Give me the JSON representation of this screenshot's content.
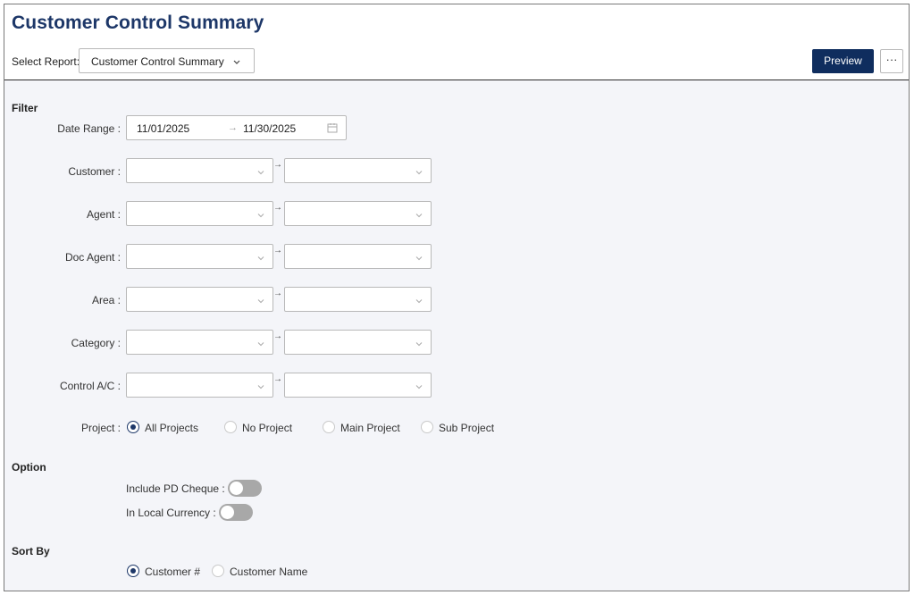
{
  "header": {
    "title": "Customer Control Summary",
    "select_report_label": "Select Report:",
    "selected_report": "Customer Control Summary",
    "preview_label": "Preview",
    "more_label": "···"
  },
  "filter": {
    "section_label": "Filter",
    "date_range": {
      "label": "Date Range :",
      "from": "11/01/2025",
      "arrow": "→",
      "to": "11/30/2025"
    },
    "ranges": [
      {
        "label": "Customer :",
        "from": "",
        "to": ""
      },
      {
        "label": "Agent :",
        "from": "",
        "to": ""
      },
      {
        "label": "Doc Agent :",
        "from": "",
        "to": ""
      },
      {
        "label": "Area :",
        "from": "",
        "to": ""
      },
      {
        "label": "Category :",
        "from": "",
        "to": ""
      },
      {
        "label": "Control A/C :",
        "from": "",
        "to": ""
      }
    ],
    "range_arrow": "→",
    "project": {
      "label": "Project :",
      "options": [
        "All Projects",
        "No Project",
        "Main Project",
        "Sub Project"
      ],
      "selected": "All Projects"
    }
  },
  "option": {
    "section_label": "Option",
    "include_pd_cheque_label": "Include PD Cheque :",
    "include_pd_cheque": false,
    "in_local_currency_label": "In Local Currency :",
    "in_local_currency": false
  },
  "sort_by": {
    "section_label": "Sort By",
    "options": [
      "Customer #",
      "Customer Name"
    ],
    "selected": "Customer #"
  },
  "colors": {
    "title": "#1d3768",
    "primary_button": "#0f2d5e",
    "background": "#f4f5f9",
    "toggle_off": "#a8a8a8"
  }
}
